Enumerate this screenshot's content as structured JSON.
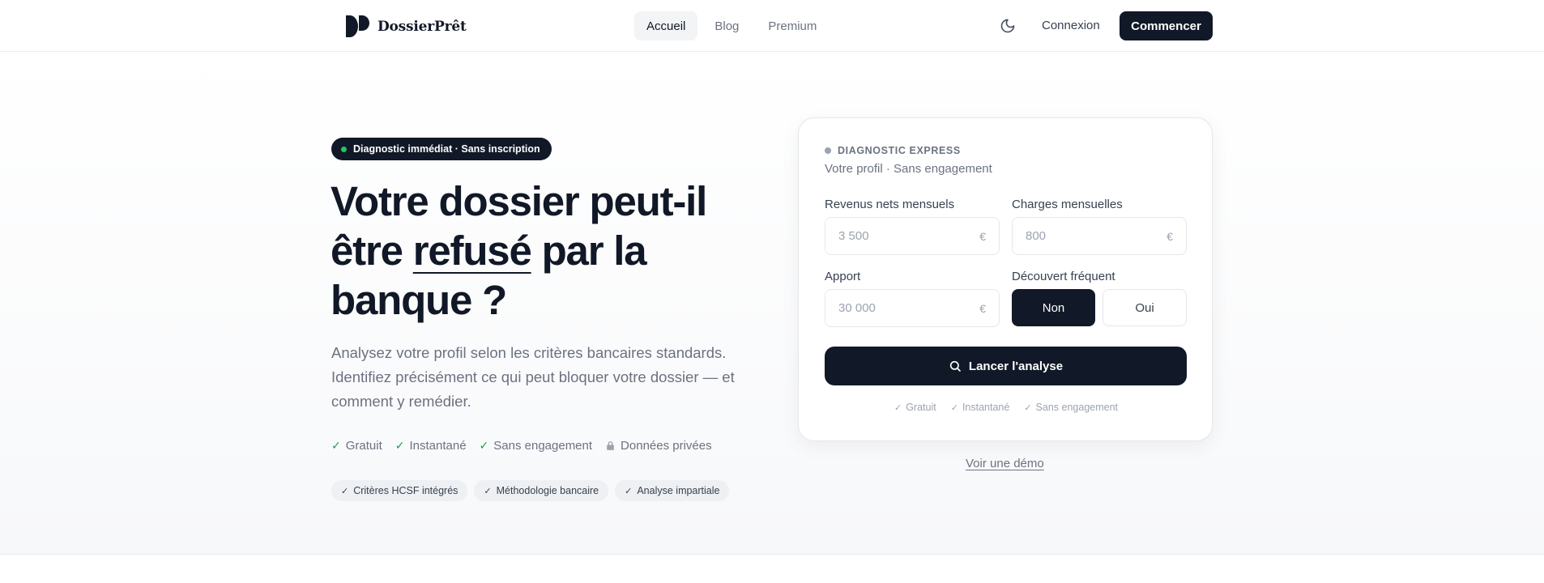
{
  "header": {
    "brand": "DossierPrêt",
    "nav": [
      {
        "label": "Accueil",
        "active": true
      },
      {
        "label": "Blog",
        "active": false
      },
      {
        "label": "Premium",
        "active": false
      }
    ],
    "theme_icon": "moon-icon",
    "login_label": "Connexion",
    "cta_label": "Commencer"
  },
  "hero": {
    "badge": "Diagnostic immédiat · Sans inscription",
    "headline_part1": "Votre dossier peut-il être ",
    "headline_accent": "refusé",
    "headline_part2": " par la banque ?",
    "lead": "Analysez votre profil selon les critères bancaires standards. Identifiez précisément ce qui peut bloquer votre dossier — et comment y remédier.",
    "features": [
      {
        "icon": "check-icon",
        "label": "Gratuit"
      },
      {
        "icon": "check-icon",
        "label": "Instantané"
      },
      {
        "icon": "check-icon",
        "label": "Sans engagement"
      },
      {
        "icon": "lock-icon",
        "label": "Données privées"
      }
    ],
    "chips": [
      "Critères HCSF intégrés",
      "Méthodologie bancaire",
      "Analyse impartiale"
    ]
  },
  "card": {
    "eyebrow": "DIAGNOSTIC EXPRESS",
    "subtitle": "Votre profil · Sans engagement",
    "income": {
      "label": "Revenus nets mensuels",
      "placeholder": "3 500",
      "unit": "€"
    },
    "charges": {
      "label": "Charges mensuelles",
      "placeholder": "800",
      "unit": "€"
    },
    "apport": {
      "label": "Apport",
      "placeholder": "30 000",
      "unit": "€"
    },
    "overdraft": {
      "label": "Découvert fréquent",
      "options": [
        "Non",
        "Oui"
      ],
      "selected": "Non"
    },
    "analyze_label": "Lancer l'analyse",
    "analyze_icon": "search-icon",
    "checks": [
      "Gratuit",
      "Instantané",
      "Sans engagement"
    ]
  },
  "demo_link": "Voir une démo",
  "colors": {
    "primary": "#111827",
    "success": "#16a34a",
    "badge_dot": "#22c55e",
    "muted_text": "#6b7280",
    "border": "#e5e7eb"
  }
}
